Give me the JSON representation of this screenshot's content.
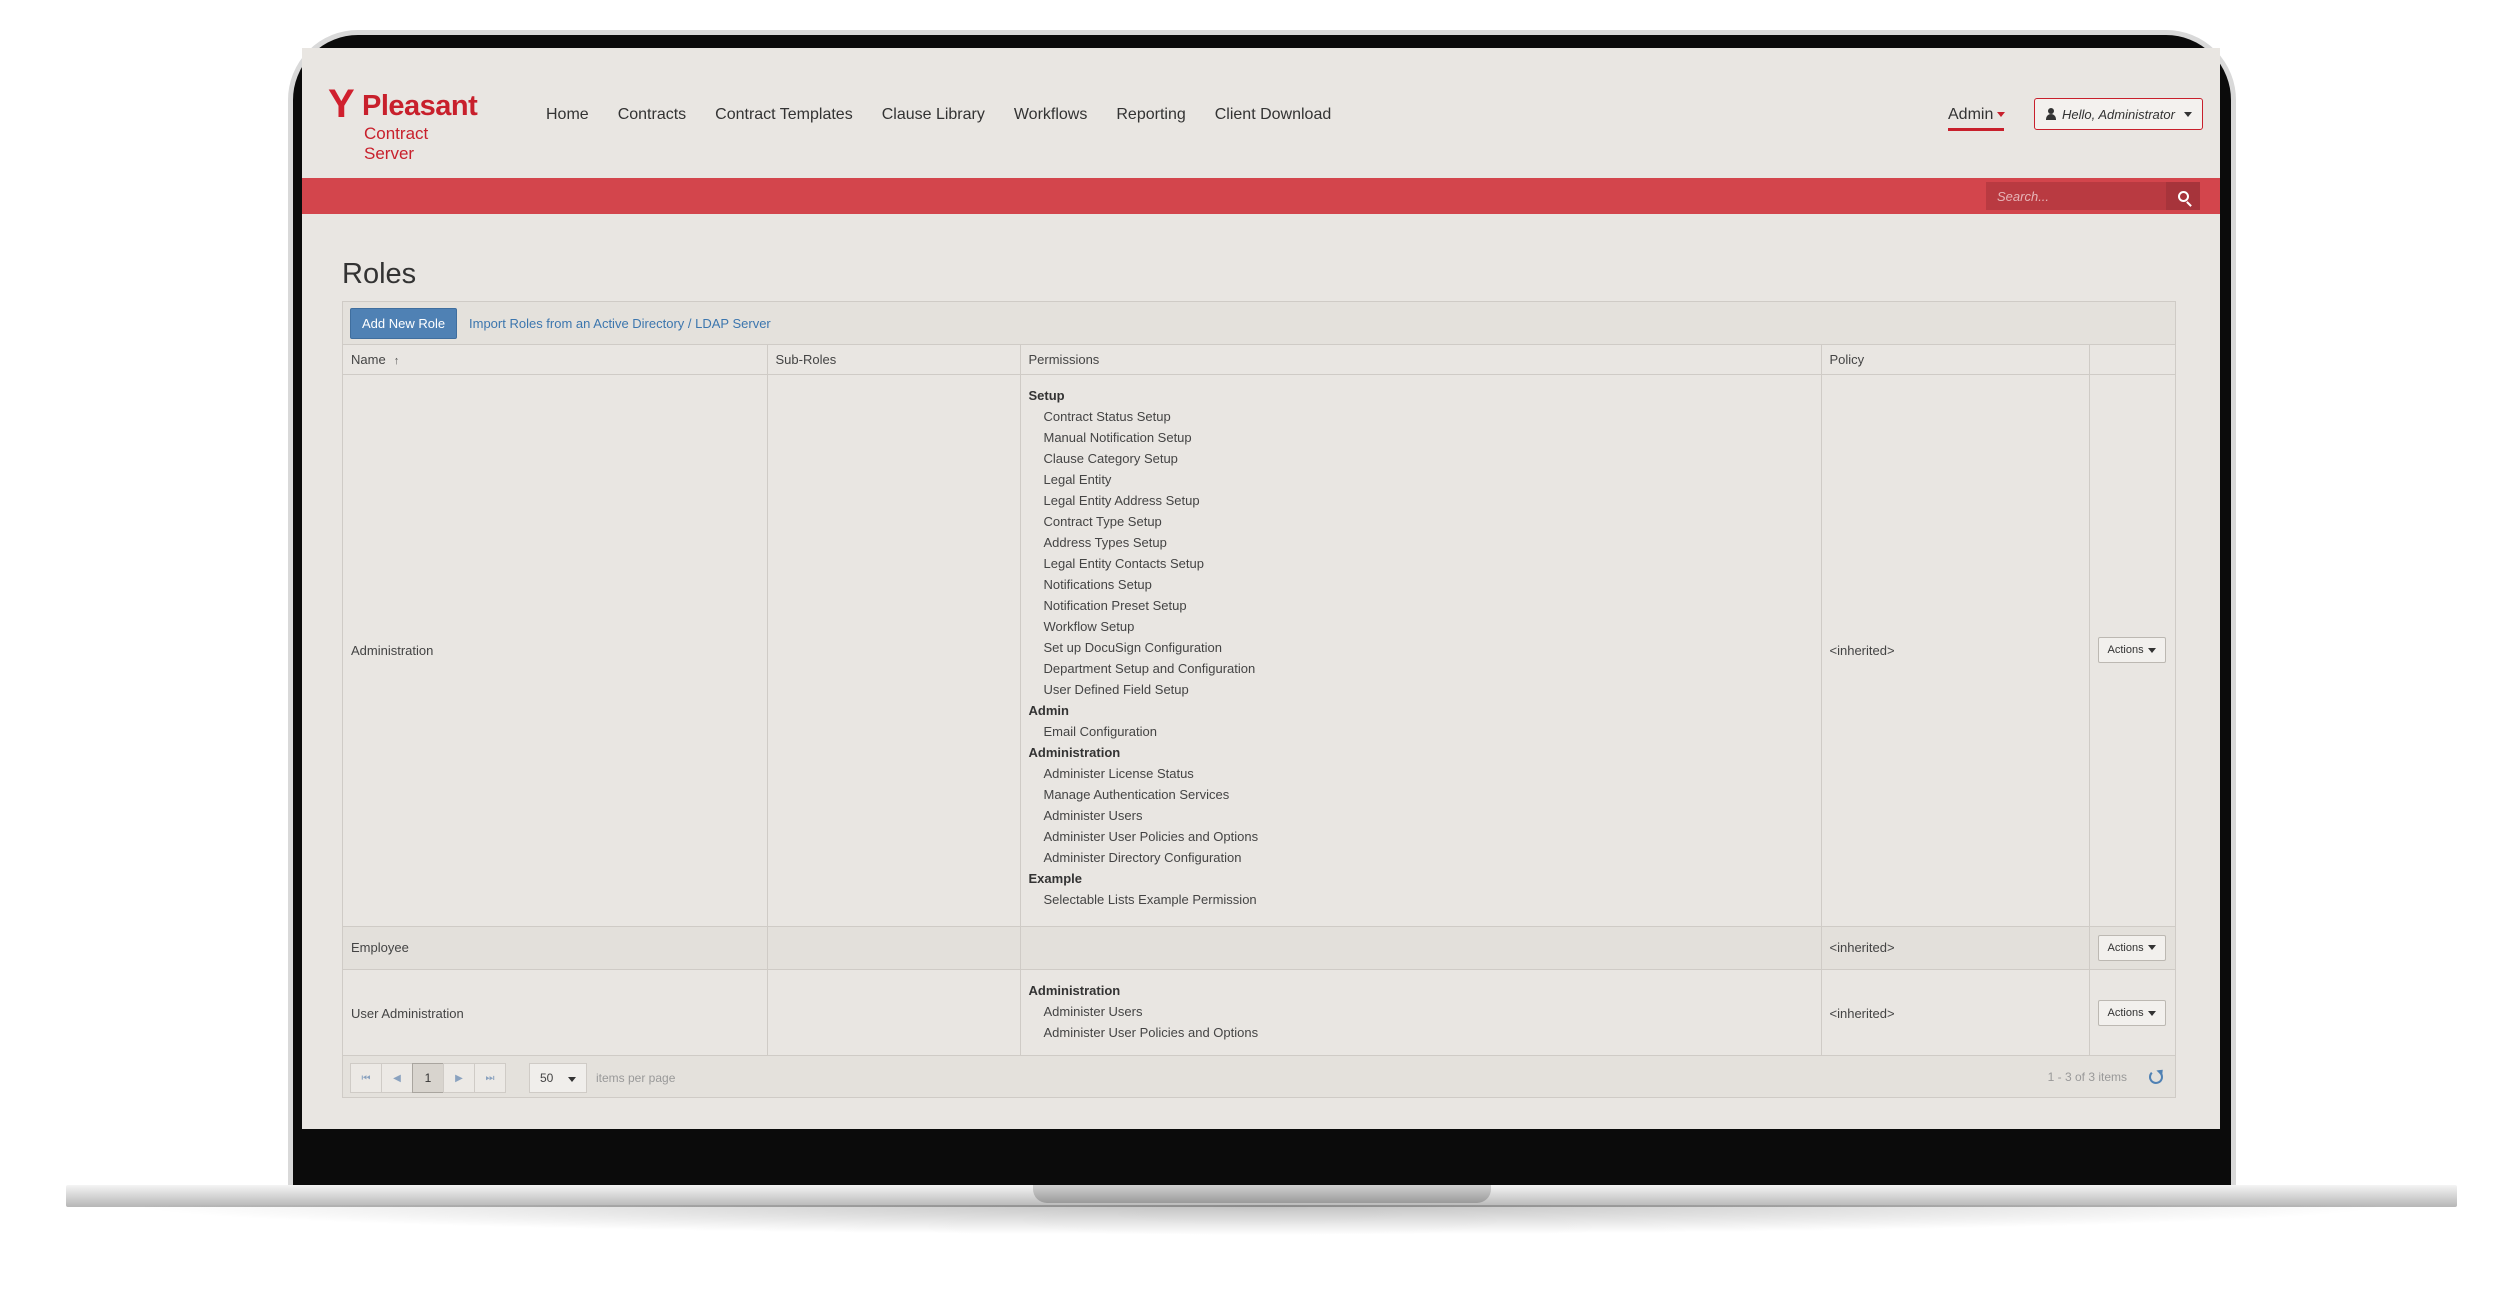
{
  "brand": {
    "name": "Pleasant",
    "product": "Contract Server"
  },
  "nav": {
    "items": [
      "Home",
      "Contracts",
      "Contract Templates",
      "Clause Library",
      "Workflows",
      "Reporting",
      "Client Download"
    ],
    "admin_label": "Admin",
    "user_label": "Hello, Administrator"
  },
  "search": {
    "placeholder": "Search..."
  },
  "page": {
    "title": "Roles"
  },
  "toolbar": {
    "add_label": "Add New Role",
    "import_label": "Import Roles from an Active Directory / LDAP Server"
  },
  "table": {
    "columns": [
      "Name",
      "Sub-Roles",
      "Permissions",
      "Policy",
      ""
    ],
    "sort_indicator": "↑",
    "rows": [
      {
        "name": "Administration",
        "sub_roles": "",
        "policy": "<inherited>",
        "action": "Actions",
        "permissions": [
          {
            "group": "Setup",
            "items": [
              "Contract Status Setup",
              "Manual Notification Setup",
              "Clause Category Setup",
              "Legal Entity",
              "Legal Entity Address Setup",
              "Contract Type Setup",
              "Address Types Setup",
              "Legal Entity Contacts Setup",
              "Notifications Setup",
              "Notification Preset Setup",
              "Workflow Setup",
              "Set up DocuSign Configuration",
              "Department Setup and Configuration",
              "User Defined Field Setup"
            ]
          },
          {
            "group": "Admin",
            "items": [
              "Email Configuration"
            ]
          },
          {
            "group": "Administration",
            "items": [
              "Administer License Status",
              "Manage Authentication Services",
              "Administer Users",
              "Administer User Policies and Options",
              "Administer Directory Configuration"
            ]
          },
          {
            "group": "Example",
            "items": [
              "Selectable Lists Example Permission"
            ]
          }
        ]
      },
      {
        "name": "Employee",
        "sub_roles": "",
        "policy": "<inherited>",
        "action": "Actions",
        "permissions": []
      },
      {
        "name": "User Administration",
        "sub_roles": "",
        "policy": "<inherited>",
        "action": "Actions",
        "permissions": [
          {
            "group": "Administration",
            "items": [
              "Administer Users",
              "Administer User Policies and Options"
            ]
          }
        ]
      }
    ]
  },
  "pager": {
    "first": "⏮",
    "prev": "◀",
    "current": "1",
    "next": "▶",
    "last": "⏭",
    "per_page": "50",
    "per_page_label": "items per page",
    "range": "1 - 3 of 3 items"
  },
  "colors": {
    "accent_red": "#d3454c",
    "brand_red": "#c8202c",
    "primary_blue": "#4f81b4"
  }
}
